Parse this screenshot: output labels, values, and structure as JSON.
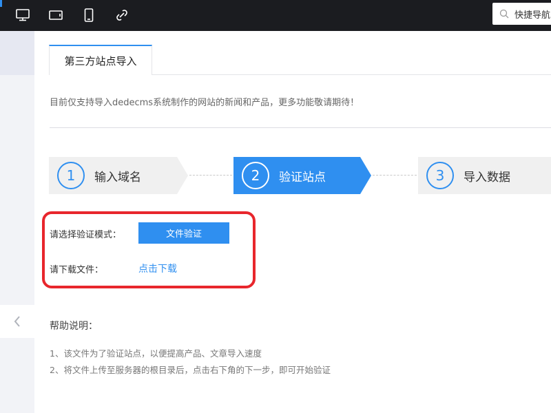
{
  "toolbar": {
    "icons": [
      "desktop-icon",
      "tablet-icon",
      "mobile-icon",
      "link-icon"
    ],
    "search": {
      "icon": "search-icon",
      "placeholder": "快捷导航"
    }
  },
  "tabs": [
    {
      "label": "第三方站点导入",
      "active": true
    }
  ],
  "notice": "目前仅支持导入dedecms系统制作的网站的新闻和产品，更多功能敬请期待！",
  "steps": [
    {
      "number": "1",
      "label": "输入域名",
      "active": false
    },
    {
      "number": "2",
      "label": "验证站点",
      "active": true
    },
    {
      "number": "3",
      "label": "导入数据",
      "active": false
    }
  ],
  "verify": {
    "mode_label": "请选择验证模式：",
    "mode_button": "文件验证",
    "download_label": "请下载文件：",
    "download_link": "点击下载"
  },
  "help": {
    "title": "帮助说明：",
    "lines": [
      "1、该文件为了验证站点，以便提高产品、文章导入速度",
      "2、将文件上传至服务器的根目录后，点击右下角的下一步，即可开始验证"
    ]
  },
  "colors": {
    "accent": "#2f8ff0",
    "highlight": "#e8262c",
    "topbar": "#1b1c20"
  }
}
